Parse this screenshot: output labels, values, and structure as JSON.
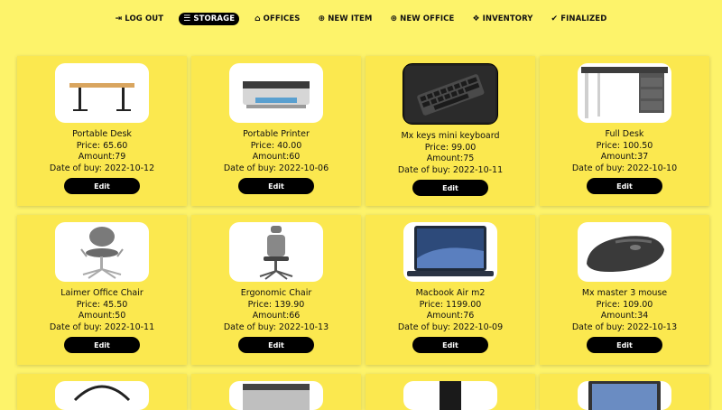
{
  "nav": [
    {
      "label": "LOG OUT",
      "icon": "logout-icon",
      "glyph": "⇥",
      "active": false
    },
    {
      "label": "STORAGE",
      "icon": "database-icon",
      "glyph": "☰",
      "active": true
    },
    {
      "label": "OFFICES",
      "icon": "home-icon",
      "glyph": "⌂",
      "active": false
    },
    {
      "label": "NEW ITEM",
      "icon": "plus-circle-icon",
      "glyph": "⊕",
      "active": false
    },
    {
      "label": "NEW OFFICE",
      "icon": "plus-circle-icon",
      "glyph": "⊕",
      "active": false
    },
    {
      "label": "INVENTORY",
      "icon": "boxes-icon",
      "glyph": "❖",
      "active": false
    },
    {
      "label": "FINALIZED",
      "icon": "check-circle-icon",
      "glyph": "✔",
      "active": false
    }
  ],
  "items": [
    {
      "name": "Portable Desk",
      "price": "Price: 65.60",
      "amount": "Amount:79",
      "date": "Date of buy: 2022-10-12",
      "edit": "Edit",
      "image": "desk-icon"
    },
    {
      "name": "Portable Printer",
      "price": "Price: 40.00",
      "amount": "Amount:60",
      "date": "Date of buy: 2022-10-06",
      "edit": "Edit",
      "image": "printer-icon"
    },
    {
      "name": "Mx keys mini keyboard",
      "price": "Price: 99.00",
      "amount": "Amount:75",
      "date": "Date of buy: 2022-10-11",
      "edit": "Edit",
      "image": "keyboard-icon"
    },
    {
      "name": "Full Desk",
      "price": "Price: 100.50",
      "amount": "Amount:37",
      "date": "Date of buy: 2022-10-10",
      "edit": "Edit",
      "image": "desk-drawers-icon"
    },
    {
      "name": "Laimer Office Chair",
      "price": "Price: 45.50",
      "amount": "Amount:50",
      "date": "Date of buy: 2022-10-11",
      "edit": "Edit",
      "image": "chair-icon"
    },
    {
      "name": "Ergonomic Chair",
      "price": "Price: 139.90",
      "amount": "Amount:66",
      "date": "Date of buy: 2022-10-13",
      "edit": "Edit",
      "image": "ergonomic-chair-icon"
    },
    {
      "name": "Macbook Air m2",
      "price": "Price: 1199.00",
      "amount": "Amount:76",
      "date": "Date of buy: 2022-10-09",
      "edit": "Edit",
      "image": "laptop-icon"
    },
    {
      "name": "Mx master 3 mouse",
      "price": "Price: 109.00",
      "amount": "Amount:34",
      "date": "Date of buy: 2022-10-13",
      "edit": "Edit",
      "image": "mouse-icon"
    }
  ],
  "partial_items": [
    {
      "image": "cable-icon"
    },
    {
      "image": "printer-icon"
    },
    {
      "image": "desktop-tower-icon"
    },
    {
      "image": "tablet-icon"
    }
  ]
}
